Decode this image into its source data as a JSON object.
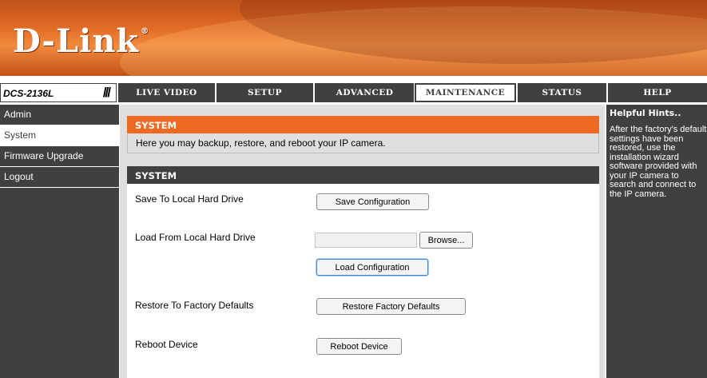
{
  "brand": {
    "logo": "D-Link",
    "registered": "®"
  },
  "nav": {
    "model": "DCS-2136L",
    "slashes": "///",
    "tabs": [
      {
        "label": "LIVE VIDEO"
      },
      {
        "label": "SETUP"
      },
      {
        "label": "ADVANCED"
      },
      {
        "label": "MAINTENANCE",
        "active": true
      },
      {
        "label": "STATUS"
      },
      {
        "label": "HELP"
      }
    ]
  },
  "sidebar": {
    "items": [
      {
        "label": "Admin"
      },
      {
        "label": "System",
        "active": true
      },
      {
        "label": "Firmware Upgrade"
      },
      {
        "label": "Logout"
      }
    ]
  },
  "main": {
    "header": "SYSTEM",
    "intro": "Here you may backup, restore, and reboot your IP camera.",
    "section_title": "SYSTEM",
    "save_label": "Save To Local Hard Drive",
    "save_button": "Save Configuration",
    "load_label": "Load From Local Hard Drive",
    "file_value": "",
    "browse_button": "Browse...",
    "load_button": "Load Configuration",
    "restore_label": "Restore To Factory Defaults",
    "restore_button": "Restore Factory Defaults",
    "reboot_label": "Reboot Device",
    "reboot_button": "Reboot Device"
  },
  "hints": {
    "title": "Helpful Hints..",
    "text": "After the factory's default settings have been restored, use the installation wizard software provided with your IP camera to search and connect to the IP camera."
  },
  "colors": {
    "accent": "#ee6a22",
    "dark": "#404040",
    "panel_bg": "#dfdfdf"
  }
}
